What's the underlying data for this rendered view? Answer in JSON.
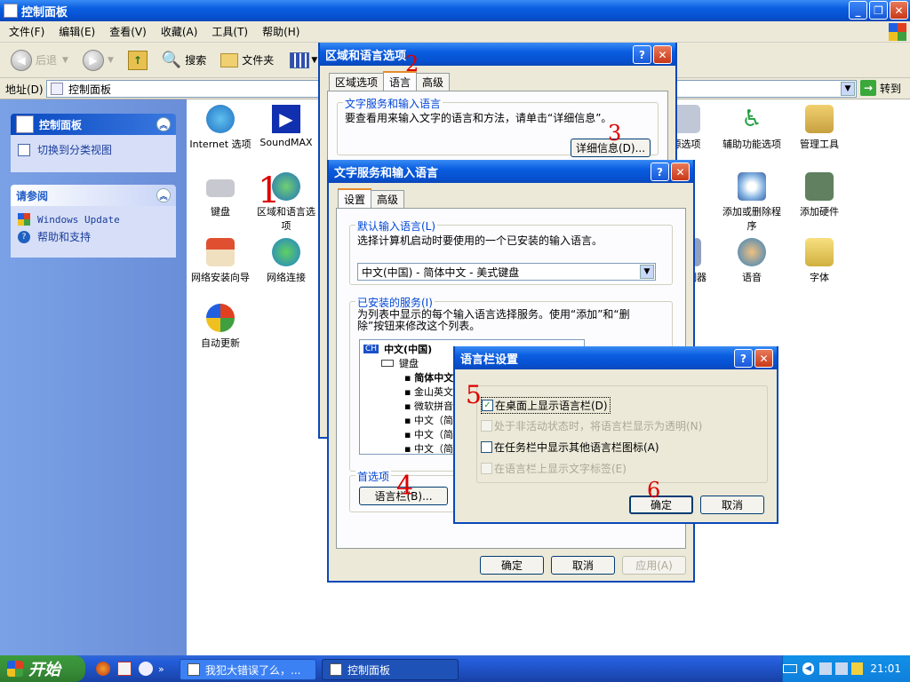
{
  "window": {
    "title": "控制面板"
  },
  "menu": [
    "文件(F)",
    "编辑(E)",
    "查看(V)",
    "收藏(A)",
    "工具(T)",
    "帮助(H)"
  ],
  "toolbar": {
    "back": "后退",
    "search": "搜索",
    "folders": "文件夹"
  },
  "address": {
    "label": "地址(D)",
    "value": "控制面板",
    "go": "转到"
  },
  "leftpane": {
    "panel1": {
      "title": "控制面板",
      "link": "切换到分类视图"
    },
    "panel2": {
      "title": "请参阅",
      "links": [
        "Windows Update",
        "帮助和支持"
      ]
    }
  },
  "icons": [
    {
      "label": "Internet 选项"
    },
    {
      "label": "SoundMAX"
    },
    {
      "label": "键盘"
    },
    {
      "label": "区域和语言选项"
    },
    {
      "label": "网络安装向导"
    },
    {
      "label": "网络连接"
    },
    {
      "label": "自动更新"
    },
    {
      "label": "源选项"
    },
    {
      "label": "辅助功能选项"
    },
    {
      "label": "管理工具"
    },
    {
      "label": "添加或删除程序"
    },
    {
      "label": "添加硬件"
    },
    {
      "label": "制器"
    },
    {
      "label": "语音"
    },
    {
      "label": "字体"
    }
  ],
  "region_dialog": {
    "title": "区域和语言选项",
    "tabs": [
      "区域选项",
      "语言",
      "高级"
    ],
    "group": "文字服务和输入语言",
    "text": "要查看用来输入文字的语言和方法，请单击“详细信息”。",
    "details_btn": "详细信息(D)..."
  },
  "text_services_dialog": {
    "title": "文字服务和输入语言",
    "tabs": [
      "设置",
      "高级"
    ],
    "default_group": "默认输入语言(L)",
    "default_text": "选择计算机启动时要使用的一个已安装的输入语言。",
    "default_value": "中文(中国) - 简体中文 - 美式键盘",
    "installed_group": "已安装的服务(I)",
    "installed_text": "为列表中显示的每个输入语言选择服务。使用“添加”和“删除”按钮来修改这个列表。",
    "tree": {
      "lang_badge": "CH",
      "lang": "中文(中国)",
      "keyboard": "键盘",
      "items": [
        "简体中文",
        "金山英文",
        "微软拼音",
        "中文（简",
        "中文（简",
        "中文（简"
      ]
    },
    "prefs_group": "首选项",
    "langbar_btn": "语言栏(B)...",
    "ok": "确定",
    "cancel": "取消",
    "apply": "应用(A)"
  },
  "langbar_dialog": {
    "title": "语言栏设置",
    "options": [
      {
        "label": "在桌面上显示语言栏(D)",
        "checked": "✓"
      },
      {
        "label": "处于非活动状态时，将语言栏显示为透明(N)",
        "checked": ""
      },
      {
        "label": "在任务栏中显示其他语言栏图标(A)",
        "checked": ""
      },
      {
        "label": "在语言栏上显示文字标签(E)",
        "checked": ""
      }
    ],
    "ok": "确定",
    "cancel": "取消"
  },
  "annotations": [
    "1",
    "2",
    "3",
    "4",
    "5",
    "6"
  ],
  "taskbar": {
    "start": "开始",
    "tasks": [
      "我犯大错误了么，...",
      "控制面板"
    ],
    "time": "21:01"
  },
  "colors": {
    "xp_blue": "#0a5de0",
    "left_pane": "#7aa1e6",
    "dialog_bg": "#ece9d8",
    "annotation": "#dd0000"
  }
}
